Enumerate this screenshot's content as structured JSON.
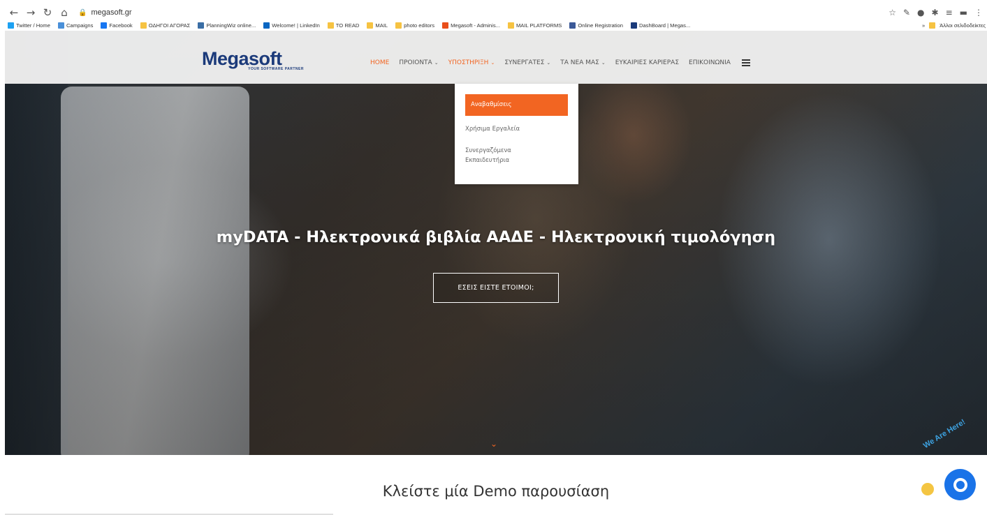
{
  "browser": {
    "url": "megasoft.gr",
    "bookmarks": [
      {
        "label": "Twitter / Home",
        "color": "#1da1f2"
      },
      {
        "label": "Campaigns",
        "color": "#4a90d9"
      },
      {
        "label": "Facebook",
        "color": "#1877f2"
      },
      {
        "label": "ΟΔΗΓΟΙ ΑΓΟΡΑΣ",
        "color": "#f6c342"
      },
      {
        "label": "PlanningWiz online...",
        "color": "#3a6ea5"
      },
      {
        "label": "Welcome! | LinkedIn",
        "color": "#0a66c2"
      },
      {
        "label": "TO READ",
        "color": "#f6c342"
      },
      {
        "label": "MAIL",
        "color": "#f6c342"
      },
      {
        "label": "photo editors",
        "color": "#f6c342"
      },
      {
        "label": "Megasoft - Adminis...",
        "color": "#e94e1b"
      },
      {
        "label": "MAIL PLATFORMS",
        "color": "#f6c342"
      },
      {
        "label": "Online Registration",
        "color": "#3b5998"
      },
      {
        "label": "DashBoard | Megas...",
        "color": "#1b3a7a"
      }
    ],
    "other_bookmarks": "Άλλοι σελιδοδείκτες",
    "more_bookmarks": "»"
  },
  "site": {
    "logo_text": "Megasoft",
    "logo_tagline": "YOUR SOFTWARE PARTNER",
    "menu": [
      {
        "label": "HOME",
        "active": true,
        "dropdown": false
      },
      {
        "label": "ΠΡΟΙΟΝΤΑ",
        "active": false,
        "dropdown": true
      },
      {
        "label": "ΥΠΟΣΤΗΡΙΞΗ",
        "active": true,
        "dropdown": true
      },
      {
        "label": "ΣΥΝΕΡΓΑΤΕΣ",
        "active": false,
        "dropdown": true
      },
      {
        "label": "ΤΑ ΝΕΑ ΜΑΣ",
        "active": false,
        "dropdown": true
      },
      {
        "label": "ΕΥΚΑΙΡΙΕΣ ΚΑΡΙΕΡΑΣ",
        "active": false,
        "dropdown": false
      },
      {
        "label": "ΕΠΙΚΟΙΝΩΝΙΑ",
        "active": false,
        "dropdown": false
      }
    ],
    "dropdown": {
      "items": [
        "Αναβαθμίσεις",
        "Χρήσιμα Εργαλεία",
        "Συνεργαζόμενα",
        "Εκπαιδευτήρια"
      ]
    },
    "hero_title": "myDATA - Ηλεκτρονικά βιβλία ΑΑΔΕ - Ηλεκτρονική τιμολόγηση",
    "cta_label": "ΕΣΕΙΣ ΕΙΣΤΕ ΕΤΟΙΜΟΙ;",
    "section_title": "Κλείστε μία Demo παρουσίαση",
    "chat_banner": "We Are Here!"
  },
  "colors": {
    "accent": "#f26522",
    "brand": "#1b3a7a",
    "chat": "#1a73e8"
  }
}
